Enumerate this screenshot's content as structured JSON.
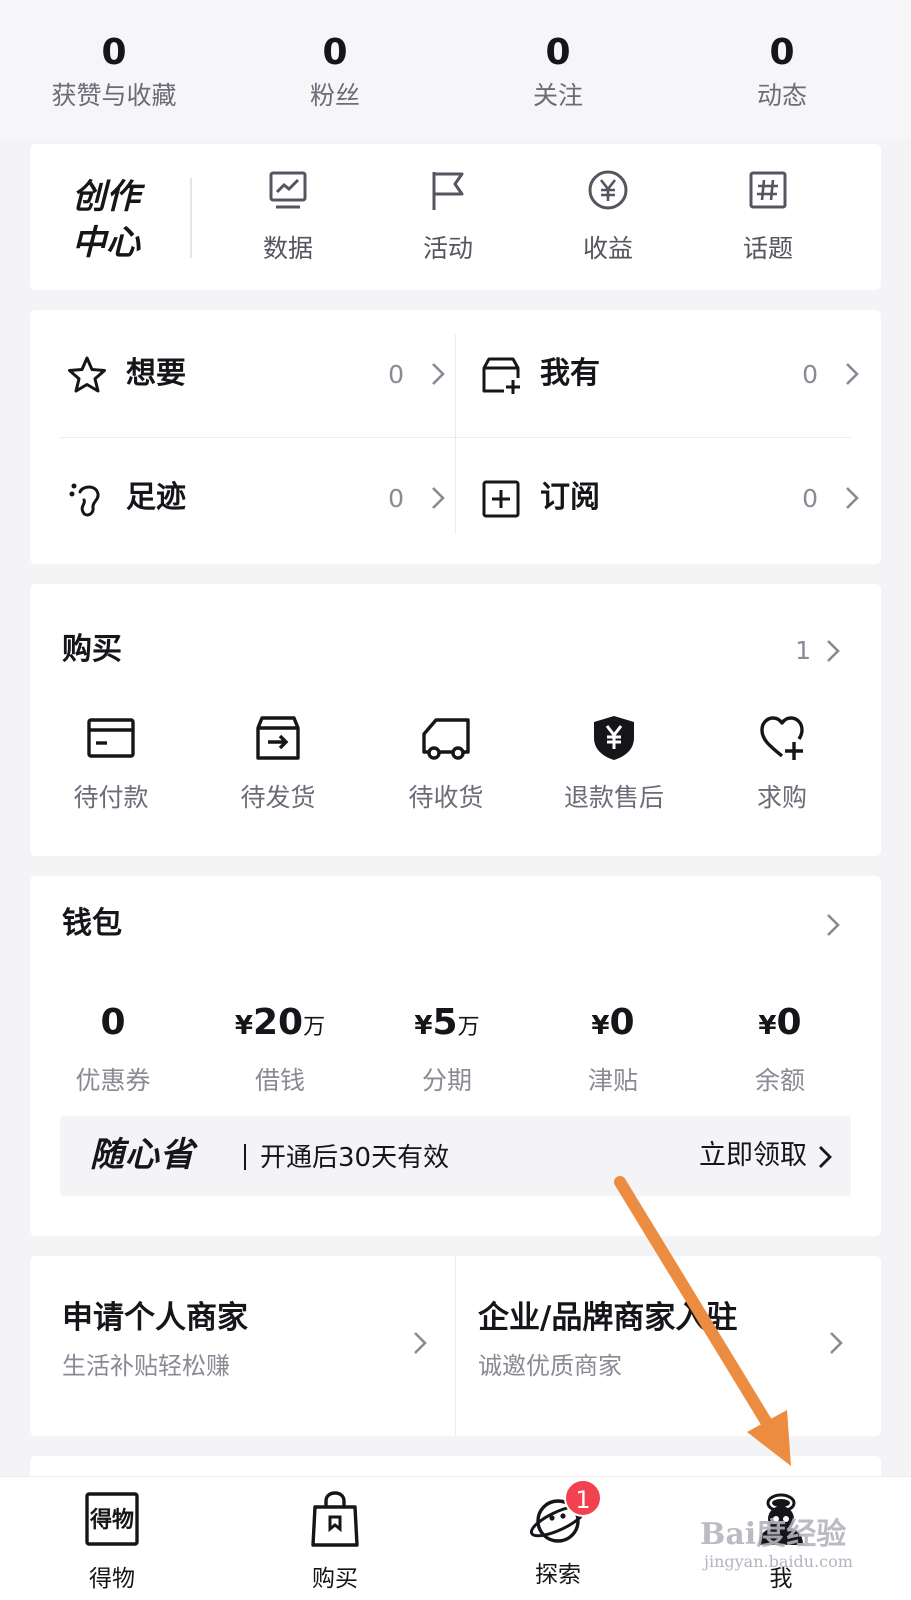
{
  "stats": [
    {
      "value": "0",
      "label": "获赞与收藏"
    },
    {
      "value": "0",
      "label": "粉丝"
    },
    {
      "value": "0",
      "label": "关注"
    },
    {
      "value": "0",
      "label": "动态"
    }
  ],
  "creator": {
    "title_line1": "创作",
    "title_line2": "中心",
    "items": [
      {
        "label": "数据",
        "icon": "data-chart-icon"
      },
      {
        "label": "活动",
        "icon": "flag-icon"
      },
      {
        "label": "收益",
        "icon": "yen-circle-icon"
      },
      {
        "label": "话题",
        "icon": "hashtag-icon"
      }
    ]
  },
  "favorites": [
    {
      "label": "想要",
      "count": "0",
      "icon": "star-icon"
    },
    {
      "label": "我有",
      "count": "0",
      "icon": "box-plus-icon"
    },
    {
      "label": "足迹",
      "count": "0",
      "icon": "footprint-icon"
    },
    {
      "label": "订阅",
      "count": "0",
      "icon": "square-plus-icon"
    }
  ],
  "purchase": {
    "title": "购买",
    "count": "1",
    "items": [
      {
        "label": "待付款",
        "icon": "card-icon"
      },
      {
        "label": "待发货",
        "icon": "box-arrow-icon"
      },
      {
        "label": "待收货",
        "icon": "truck-icon"
      },
      {
        "label": "退款售后",
        "icon": "shield-yen-icon"
      },
      {
        "label": "求购",
        "icon": "heart-plus-icon"
      }
    ]
  },
  "wallet": {
    "title": "钱包",
    "items": [
      {
        "currency": "",
        "value": "0",
        "unit": "",
        "label": "优惠券"
      },
      {
        "currency": "¥",
        "value": "20",
        "unit": "万",
        "label": "借钱"
      },
      {
        "currency": "¥",
        "value": "5",
        "unit": "万",
        "label": "分期"
      },
      {
        "currency": "¥",
        "value": "0",
        "unit": "",
        "label": "津贴"
      },
      {
        "currency": "¥",
        "value": "0",
        "unit": "",
        "label": "余额"
      }
    ],
    "promo": {
      "logo": "随心省",
      "text": "开通后30天有效",
      "action": "立即领取"
    }
  },
  "merchant": [
    {
      "title": "申请个人商家",
      "subtitle": "生活补贴轻松赚"
    },
    {
      "title": "企业/品牌商家入驻",
      "subtitle": "诚邀优质商家"
    }
  ],
  "tabbar": {
    "tabs": [
      {
        "label": "得物",
        "icon": "dewu-logo-icon"
      },
      {
        "label": "购买",
        "icon": "shopping-bag-icon"
      },
      {
        "label": "探索",
        "icon": "planet-icon",
        "badge": "1"
      },
      {
        "label": "我",
        "icon": "avatar-icon"
      }
    ]
  },
  "colors": {
    "badge": "#f24250",
    "annotation_arrow": "#eb8c41"
  },
  "watermark": {
    "main": "Bai度经验",
    "sub": "jingyan.baidu.com"
  }
}
